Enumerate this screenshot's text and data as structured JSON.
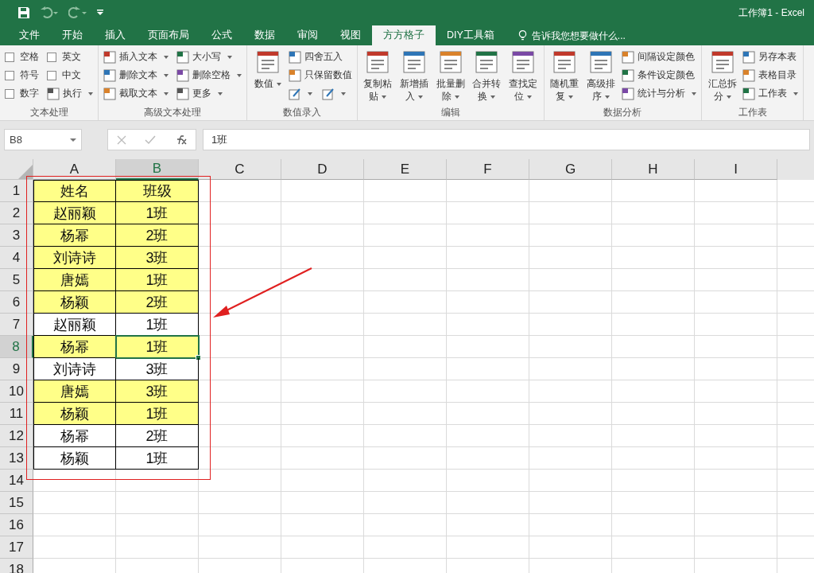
{
  "window": {
    "title": "工作簿1 - Excel"
  },
  "tabs": [
    {
      "label": "文件",
      "selected": false
    },
    {
      "label": "开始",
      "selected": false
    },
    {
      "label": "插入",
      "selected": false
    },
    {
      "label": "页面布局",
      "selected": false
    },
    {
      "label": "公式",
      "selected": false
    },
    {
      "label": "数据",
      "selected": false
    },
    {
      "label": "审阅",
      "selected": false
    },
    {
      "label": "视图",
      "selected": false
    },
    {
      "label": "方方格子",
      "selected": true
    },
    {
      "label": "DIY工具箱",
      "selected": false
    }
  ],
  "tell_me": {
    "placeholder": "告诉我您想要做什么..."
  },
  "ribbon_groups": [
    {
      "label": "文本处理",
      "items": [
        {
          "kind": "checkbox",
          "label": "空格",
          "checked": false
        },
        {
          "kind": "checkbox",
          "label": "符号",
          "checked": false
        },
        {
          "kind": "checkbox",
          "label": "数字",
          "checked": false
        },
        {
          "kind": "checkbox",
          "label": "英文",
          "checked": false
        },
        {
          "kind": "checkbox",
          "label": "中文",
          "checked": false
        },
        {
          "kind": "small",
          "label": "执行",
          "dropdown": true
        }
      ]
    },
    {
      "label": "高级文本处理",
      "items": [
        {
          "kind": "small",
          "label": "插入文本",
          "dropdown": true
        },
        {
          "kind": "small",
          "label": "删除文本",
          "dropdown": true
        },
        {
          "kind": "small",
          "label": "截取文本",
          "dropdown": true
        },
        {
          "kind": "small",
          "label": "大小写",
          "dropdown": true
        },
        {
          "kind": "small",
          "label": "删除空格",
          "dropdown": true
        },
        {
          "kind": "small",
          "label": "更多",
          "dropdown": true
        }
      ]
    },
    {
      "label": "数值录入",
      "items": [
        {
          "kind": "large",
          "label": "数值",
          "dropdown": true
        },
        {
          "kind": "small",
          "label": "四舍五入",
          "dropdown": false
        },
        {
          "kind": "small",
          "label": "只保留数值",
          "dropdown": false
        },
        {
          "kind": "icon",
          "dropdown": true
        },
        {
          "kind": "icon",
          "dropdown": true
        }
      ]
    },
    {
      "label": "编辑",
      "items": [
        {
          "kind": "large",
          "label": "复制粘贴",
          "dropdown": true
        },
        {
          "kind": "large",
          "label": "新增插入",
          "dropdown": true
        },
        {
          "kind": "large",
          "label": "批量删除",
          "dropdown": true
        },
        {
          "kind": "large",
          "label": "合并转换",
          "dropdown": true
        },
        {
          "kind": "large",
          "label": "查找定位",
          "dropdown": true
        }
      ]
    },
    {
      "label": "数据分析",
      "items": [
        {
          "kind": "large",
          "label": "随机重复",
          "dropdown": true
        },
        {
          "kind": "large",
          "label": "高级排序",
          "dropdown": true
        },
        {
          "kind": "small",
          "label": "间隔设定颜色",
          "dropdown": false
        },
        {
          "kind": "small",
          "label": "条件设定颜色",
          "dropdown": false
        },
        {
          "kind": "small",
          "label": "统计与分析",
          "dropdown": true
        }
      ]
    },
    {
      "label": "工作表",
      "items": [
        {
          "kind": "large",
          "label": "汇总拆分",
          "dropdown": true
        },
        {
          "kind": "small",
          "label": "另存本表",
          "dropdown": false
        },
        {
          "kind": "small",
          "label": "表格目录",
          "dropdown": false
        },
        {
          "kind": "small",
          "label": "工作表",
          "dropdown": true
        }
      ]
    }
  ],
  "formula_bar": {
    "name_box": "B8",
    "formula": "1班"
  },
  "sheet": {
    "columns": [
      {
        "label": "A",
        "selected": false
      },
      {
        "label": "B",
        "selected": true
      },
      {
        "label": "C",
        "selected": false
      },
      {
        "label": "D",
        "selected": false
      },
      {
        "label": "E",
        "selected": false
      },
      {
        "label": "F",
        "selected": false
      },
      {
        "label": "G",
        "selected": false
      },
      {
        "label": "H",
        "selected": false
      },
      {
        "label": "I",
        "selected": false
      }
    ],
    "rows": [
      {
        "label": "1",
        "selected": false,
        "cells": [
          {
            "text": "姓名",
            "highlight": true,
            "selected": false
          },
          {
            "text": "班级",
            "highlight": true,
            "selected": false
          }
        ]
      },
      {
        "label": "2",
        "selected": false,
        "cells": [
          {
            "text": "赵丽颖",
            "highlight": true,
            "selected": false
          },
          {
            "text": "1班",
            "highlight": true,
            "selected": false
          }
        ]
      },
      {
        "label": "3",
        "selected": false,
        "cells": [
          {
            "text": "杨幂",
            "highlight": true,
            "selected": false
          },
          {
            "text": "2班",
            "highlight": true,
            "selected": false
          }
        ]
      },
      {
        "label": "4",
        "selected": false,
        "cells": [
          {
            "text": "刘诗诗",
            "highlight": true,
            "selected": false
          },
          {
            "text": "3班",
            "highlight": true,
            "selected": false
          }
        ]
      },
      {
        "label": "5",
        "selected": false,
        "cells": [
          {
            "text": "唐嫣",
            "highlight": true,
            "selected": false
          },
          {
            "text": "1班",
            "highlight": true,
            "selected": false
          }
        ]
      },
      {
        "label": "6",
        "selected": false,
        "cells": [
          {
            "text": "杨颖",
            "highlight": true,
            "selected": false
          },
          {
            "text": "2班",
            "highlight": true,
            "selected": false
          }
        ]
      },
      {
        "label": "7",
        "selected": false,
        "cells": [
          {
            "text": "赵丽颖",
            "highlight": false,
            "selected": false
          },
          {
            "text": "1班",
            "highlight": false,
            "selected": false
          }
        ]
      },
      {
        "label": "8",
        "selected": true,
        "cells": [
          {
            "text": "杨幂",
            "highlight": true,
            "selected": false
          },
          {
            "text": "1班",
            "highlight": true,
            "selected": true
          }
        ]
      },
      {
        "label": "9",
        "selected": false,
        "cells": [
          {
            "text": "刘诗诗",
            "highlight": false,
            "selected": false
          },
          {
            "text": "3班",
            "highlight": false,
            "selected": false
          }
        ]
      },
      {
        "label": "10",
        "selected": false,
        "cells": [
          {
            "text": "唐嫣",
            "highlight": true,
            "selected": false
          },
          {
            "text": "3班",
            "highlight": true,
            "selected": false
          }
        ]
      },
      {
        "label": "11",
        "selected": false,
        "cells": [
          {
            "text": "杨颖",
            "highlight": true,
            "selected": false
          },
          {
            "text": "1班",
            "highlight": true,
            "selected": false
          }
        ]
      },
      {
        "label": "12",
        "selected": false,
        "cells": [
          {
            "text": "杨幂",
            "highlight": false,
            "selected": false
          },
          {
            "text": "2班",
            "highlight": false,
            "selected": false
          }
        ]
      },
      {
        "label": "13",
        "selected": false,
        "cells": [
          {
            "text": "杨颖",
            "highlight": false,
            "selected": false
          },
          {
            "text": "1班",
            "highlight": false,
            "selected": false
          }
        ]
      },
      {
        "label": "14",
        "selected": false,
        "cells": []
      },
      {
        "label": "15",
        "selected": false,
        "cells": []
      },
      {
        "label": "16",
        "selected": false,
        "cells": []
      },
      {
        "label": "17",
        "selected": false,
        "cells": []
      },
      {
        "label": "18",
        "selected": false,
        "cells": []
      }
    ]
  }
}
